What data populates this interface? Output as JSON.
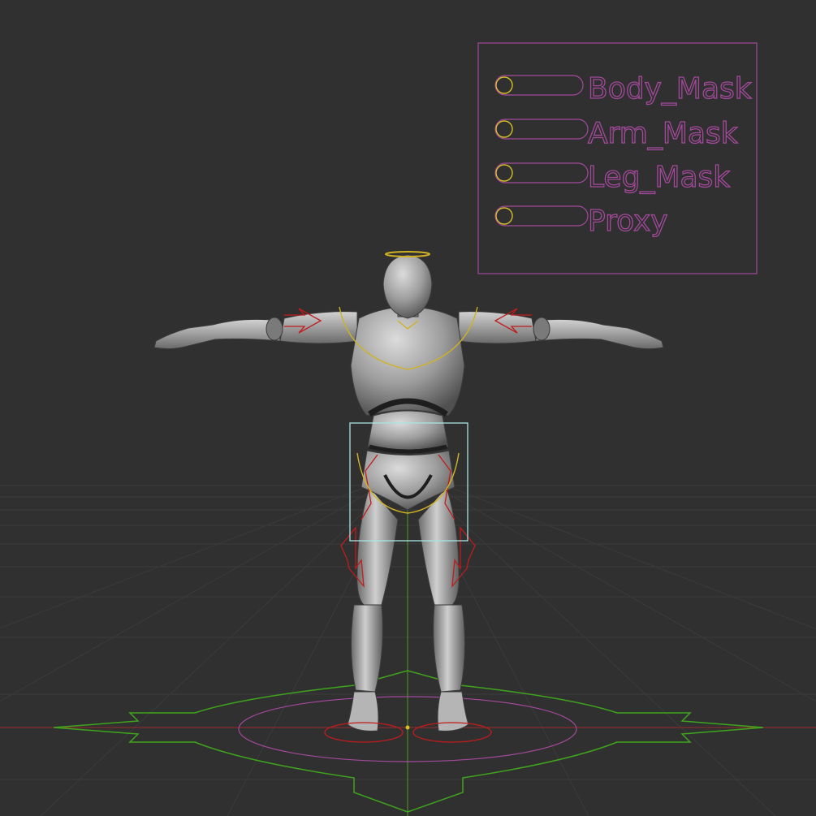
{
  "viewport": {
    "background": "#303030",
    "grid_color": "#3a3a3a",
    "axis_x_color": "#9b2a2a",
    "axis_y_color": "#4e9a1e"
  },
  "mask_panel": {
    "color": "#a3499b",
    "knob_color": "#d7bf2a",
    "items": [
      {
        "label": "Body_Mask"
      },
      {
        "label": "Arm_Mask"
      },
      {
        "label": "Leg_Mask"
      },
      {
        "label": "Proxy"
      }
    ]
  },
  "rig": {
    "fk_control_color": "#c01c1c",
    "ik_control_color": "#d0b224",
    "root_control_color": "#3fa41d",
    "hip_box_color": "#a8e3e3",
    "mesh_color": "#8e8e8e"
  }
}
